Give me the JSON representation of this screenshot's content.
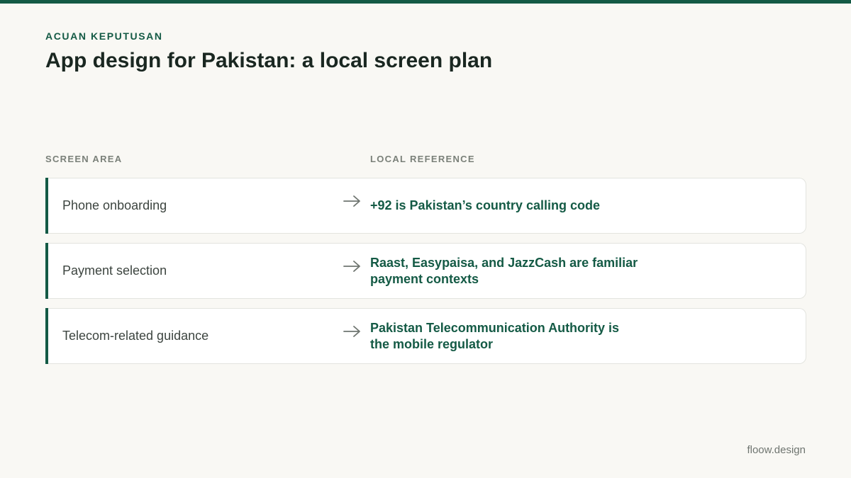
{
  "header": {
    "eyebrow": "ACUAN KEPUTUSAN",
    "title": "App design for Pakistan: a local screen plan"
  },
  "columns": {
    "left": "SCREEN AREA",
    "right": "LOCAL REFERENCE"
  },
  "rows": [
    {
      "area": "Phone onboarding",
      "reference": "+92 is Pakistan’s country calling code"
    },
    {
      "area": "Payment selection",
      "reference": "Raast, Easypaisa, and JazzCash are familiar payment contexts"
    },
    {
      "area": "Telecom-related guidance",
      "reference": "Pakistan Telecommunication Authority is the mobile regulator"
    }
  ],
  "footer": {
    "brand": "floow.design"
  },
  "colors": {
    "accent": "#145a45",
    "background": "#f9f8f4",
    "card": "#ffffff",
    "muted": "#7a8079"
  },
  "icons": {
    "row_arrow": "arrow-right-icon"
  }
}
